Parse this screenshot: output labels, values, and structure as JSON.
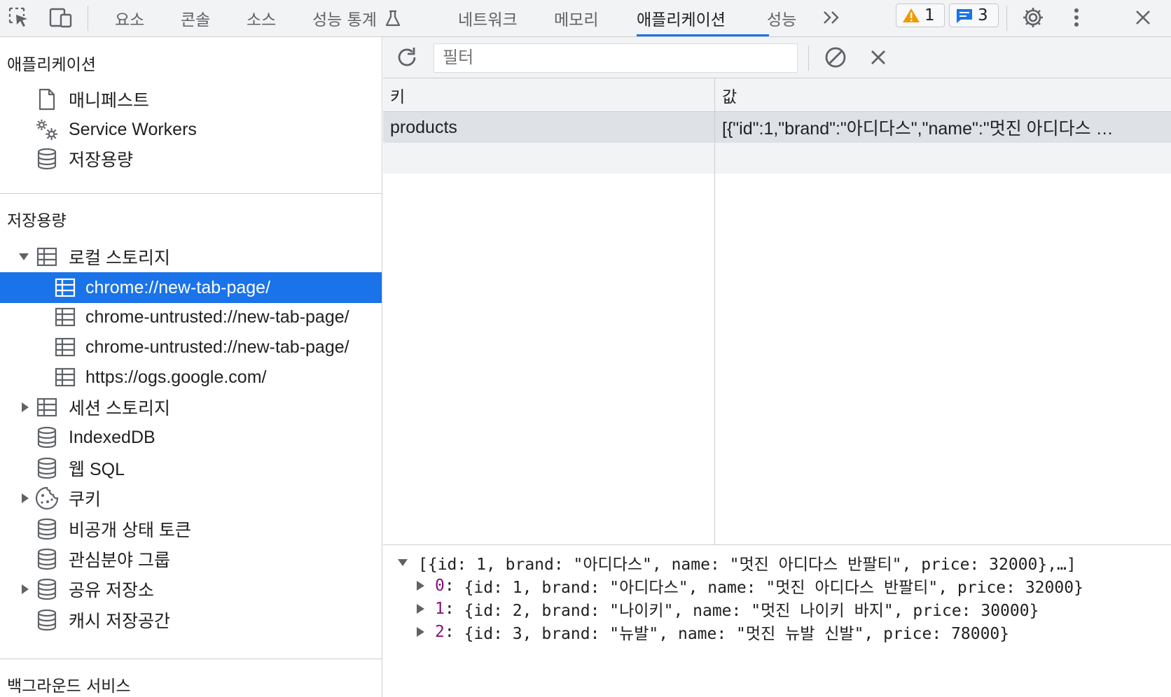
{
  "toolbar": {
    "tabs": [
      "요소",
      "콘솔",
      "소스",
      "성능 통계",
      "네트워크",
      "메모리",
      "애플리케이션",
      "성능"
    ],
    "active_tab": "애플리케이션",
    "warning_count": "1",
    "message_count": "3",
    "accent_color": "#1a73e8"
  },
  "sidebar": {
    "app_section": {
      "title": "애플리케이션",
      "items": [
        "매니페스트",
        "Service Workers",
        "저장용량"
      ]
    },
    "storage_section": {
      "title": "저장용량",
      "local_storage": {
        "label": "로컬 스토리지",
        "children": [
          "chrome://new-tab-page/",
          "chrome-untrusted://new-tab-page/",
          "chrome-untrusted://new-tab-page/",
          "https://ogs.google.com/"
        ]
      },
      "items": [
        "세션 스토리지",
        "IndexedDB",
        "웹 SQL",
        "쿠키",
        "비공개 상태 토큰",
        "관심분야 그룹",
        "공유 저장소",
        "캐시 저장공간"
      ]
    },
    "background_section": {
      "title": "백그라운드 서비스"
    }
  },
  "filter": {
    "placeholder": "필터"
  },
  "grid": {
    "columns": [
      "키",
      "값"
    ],
    "rows": [
      {
        "key": "products",
        "value": "[{\"id\":1,\"brand\":\"아디다스\",\"name\":\"멋진 아디다스 …"
      }
    ]
  },
  "preview": {
    "summary": "[{id: 1, brand: \"아디다스\", name: \"멋진 아디다스 반팔티\", price: 32000},…]",
    "items": [
      {
        "index": "0",
        "text": "{id: 1, brand: \"아디다스\", name: \"멋진 아디다스 반팔티\", price: 32000}"
      },
      {
        "index": "1",
        "text": "{id: 2, brand: \"나이키\", name: \"멋진 나이키 바지\", price: 30000}"
      },
      {
        "index": "2",
        "text": "{id: 3, brand: \"뉴발\", name: \"멋진 뉴발 신발\", price: 78000}"
      }
    ]
  }
}
